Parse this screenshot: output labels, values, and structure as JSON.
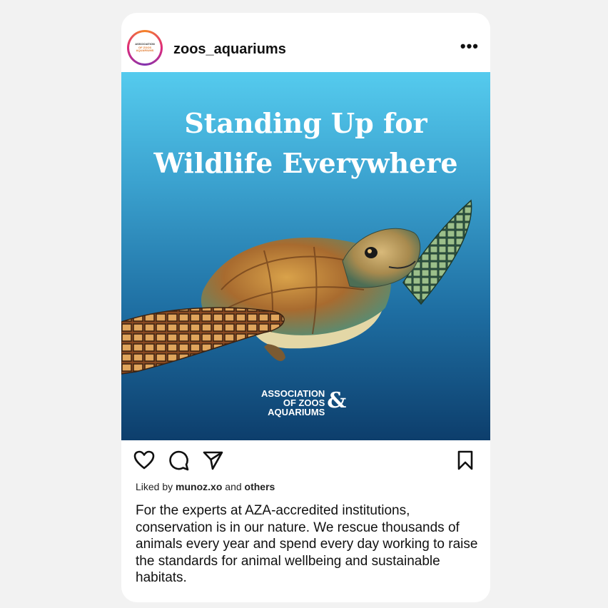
{
  "post": {
    "username": "zoos_aquariums",
    "avatar_text": [
      "ASSOCIATION",
      "OF ZOOS",
      "AQUARIUMS"
    ],
    "more_label": "•••",
    "image": {
      "headline_line1": "Standing Up for",
      "headline_line2": "Wildlife Everywhere",
      "brand_line1": "ASSOCIATION",
      "brand_line2": "OF ZOOS",
      "brand_line3": "AQUARIUMS",
      "brand_amp": "&"
    },
    "liked_by_prefix": "Liked by",
    "liked_by_user": "munoz.xo",
    "liked_by_and": "and",
    "liked_by_others": "others",
    "caption": "For the experts at AZA-accredited institutions, conservation is in our nature. We rescue thousands of animals every year and spend every day working to raise the standards for animal wellbeing and sustainable habitats."
  },
  "icons": [
    "heart-icon",
    "comment-icon",
    "share-icon",
    "bookmark-icon"
  ],
  "colors": {
    "background": "#f2f2f2",
    "card": "#ffffff",
    "sky": "#55cbee",
    "deep": "#0d3e6c"
  }
}
